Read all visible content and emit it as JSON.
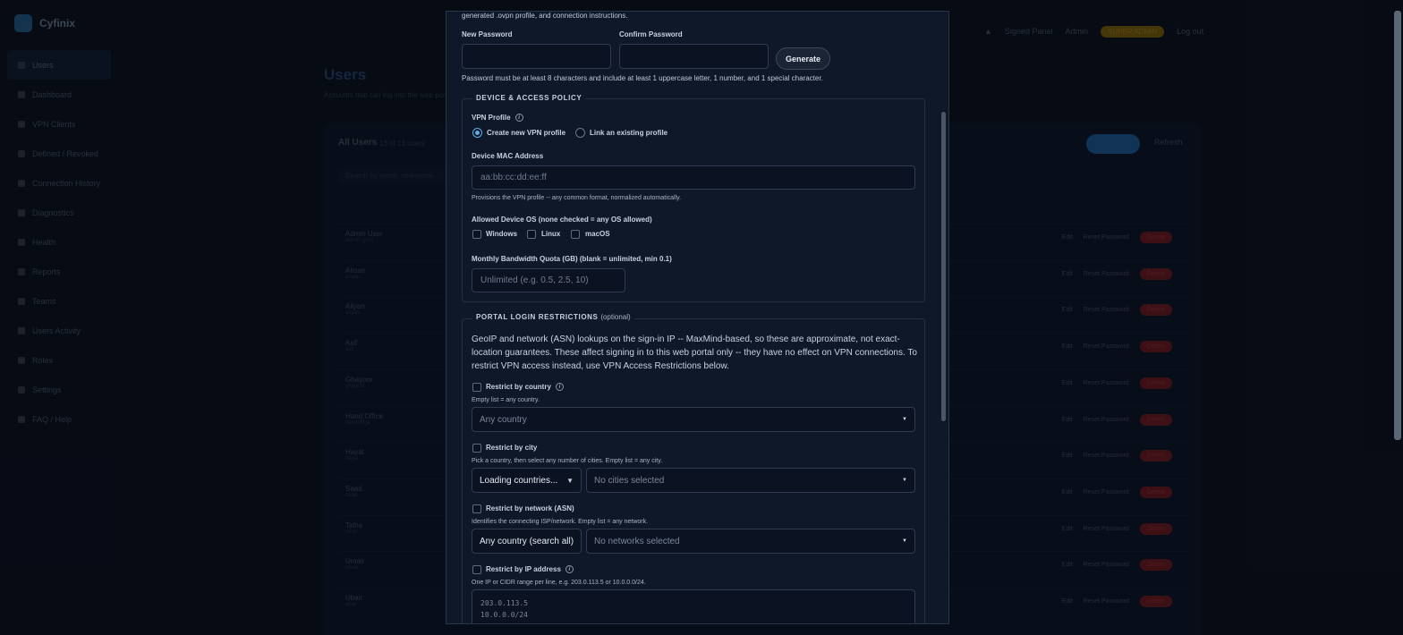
{
  "app": {
    "name": "Cyfinix"
  },
  "sidebar": {
    "items": [
      {
        "label": "Users"
      },
      {
        "label": "Dashboard"
      },
      {
        "label": "VPN Clients"
      },
      {
        "label": "Defined / Revoked"
      },
      {
        "label": "Connection History"
      },
      {
        "label": "Diagnostics"
      },
      {
        "label": "Health"
      },
      {
        "label": "Reports"
      },
      {
        "label": "Teams"
      },
      {
        "label": "Users Activity"
      },
      {
        "label": "Roles"
      },
      {
        "label": "Settings"
      },
      {
        "label": "FAQ / Help"
      }
    ]
  },
  "topbar": {
    "user": "Signed Panel",
    "role": "Admin",
    "badge": "SUPER ADMIN",
    "logout": "Log out"
  },
  "page": {
    "title": "Users",
    "subtitle": "Accounts that can log into the web portal",
    "card_title": "All Users",
    "card_count": "13 of 13 users",
    "search_placeholder": "Search by name, username...",
    "refresh": "Refresh",
    "rows": [
      {
        "name": "Admin User",
        "sub": "admin (you)"
      },
      {
        "name": "Ahsan",
        "sub": "ahsan"
      },
      {
        "name": "Aliyan",
        "sub": "aliyan"
      },
      {
        "name": "Asif",
        "sub": "asif"
      },
      {
        "name": "Ghayoor",
        "sub": "ghayoor"
      },
      {
        "name": "Hand Office",
        "sub": "handoffice"
      },
      {
        "name": "Hayat",
        "sub": "hayat"
      },
      {
        "name": "Saad",
        "sub": "saad"
      },
      {
        "name": "Talha",
        "sub": "talha"
      },
      {
        "name": "Umair",
        "sub": "umair"
      },
      {
        "name": "Ubair",
        "sub": "ubair"
      }
    ],
    "row_actions": {
      "edit": "Edit",
      "reset": "Reset Password",
      "delete": "Delete"
    }
  },
  "modal": {
    "intro_text": "generated .ovpn profile, and connection instructions.",
    "new_password_label": "New Password",
    "confirm_password_label": "Confirm Password",
    "generate_label": "Generate",
    "password_hint": "Password must be at least 8 characters and include at least 1 uppercase letter, 1 number, and 1 special character.",
    "device_section": {
      "legend": "DEVICE & ACCESS POLICY",
      "vpn_profile_label": "VPN Profile",
      "info_glyph": "i",
      "radio_create": "Create new VPN profile",
      "radio_link": "Link an existing profile",
      "mac_label": "Device MAC Address",
      "mac_placeholder": "aa:bb:cc:dd:ee:ff",
      "mac_help": "Provisions the VPN profile -- any common format, normalized automatically.",
      "os_label": "Allowed Device OS (none checked = any OS allowed)",
      "os_options": [
        "Windows",
        "Linux",
        "macOS"
      ],
      "quota_label": "Monthly Bandwidth Quota (GB) (blank = unlimited, min 0.1)",
      "quota_placeholder": "Unlimited (e.g. 0.5, 2.5, 10)"
    },
    "portal_section": {
      "legend": "PORTAL LOGIN RESTRICTIONS",
      "legend_optional": "(optional)",
      "description": "GeoIP and network (ASN) lookups on the sign-in IP -- MaxMind-based, so these are approximate, not exact-location guarantees. These affect signing in to this web portal only -- they have no effect on VPN connections. To restrict VPN access instead, use VPN Access Restrictions below.",
      "country_label": "Restrict by country",
      "country_help": "Empty list = any country.",
      "country_select": "Any country",
      "city_label": "Restrict by city",
      "city_help": "Pick a country, then select any number of cities. Empty list = any city.",
      "city_country_select": "Loading countries...",
      "city_select": "No cities selected",
      "asn_label": "Restrict by network (ASN)",
      "asn_help": "Identifies the connecting ISP/network. Empty list = any network.",
      "asn_country_select": "Any country (search all)",
      "asn_select": "No networks selected",
      "ip_label": "Restrict by IP address",
      "ip_help": "One IP or CIDR range per line, e.g. 203.0.113.5 or 10.0.0.0/24.",
      "ip_placeholder": "203.0.113.5\n10.0.0.0/24"
    }
  }
}
